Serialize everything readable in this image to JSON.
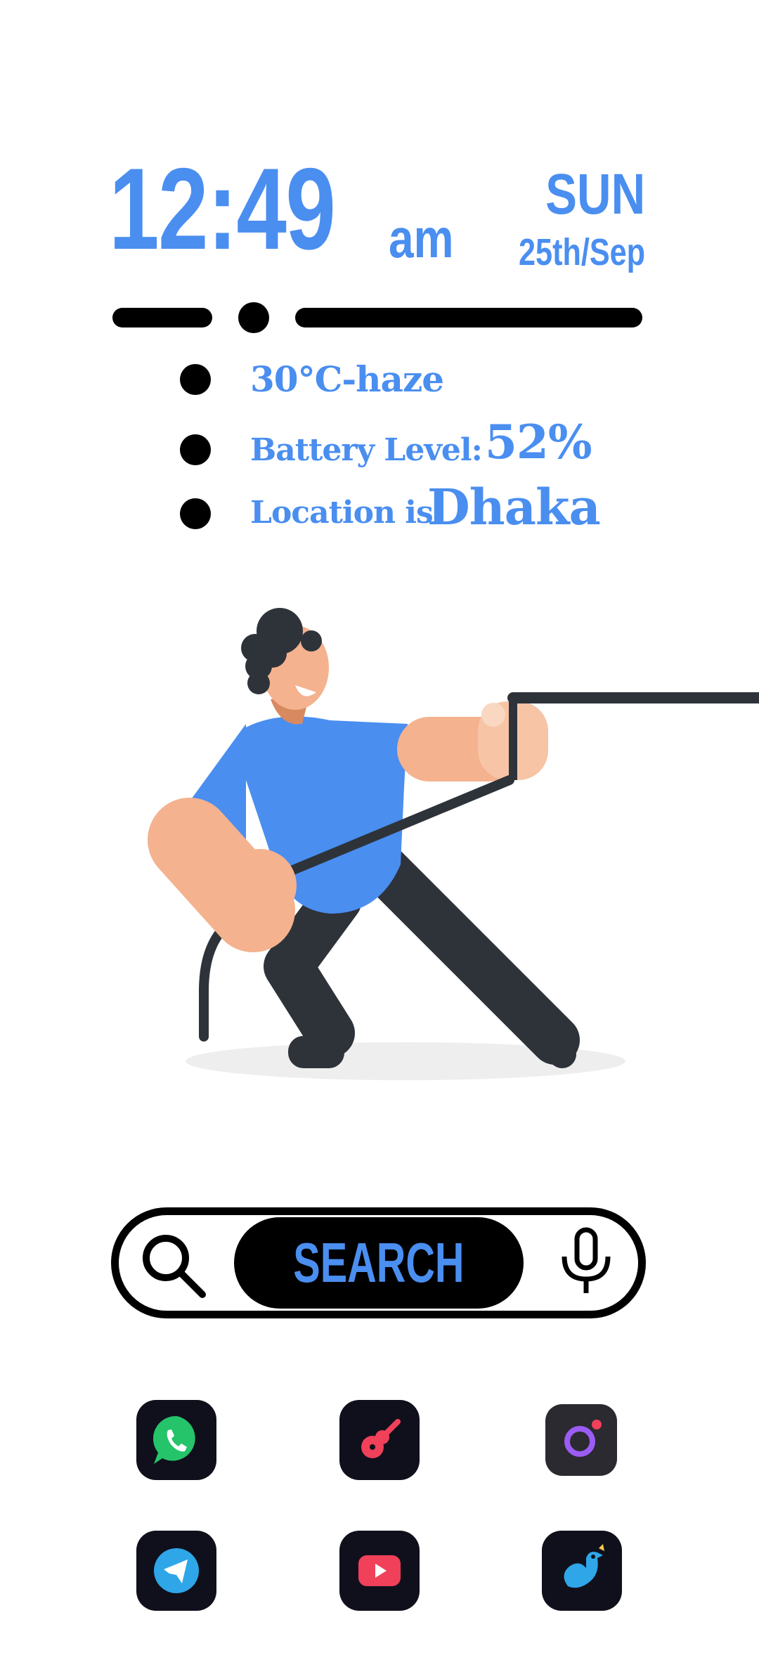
{
  "clock": {
    "time": "12:49",
    "ampm": "am",
    "day": "SUN",
    "date": "25th/Sep"
  },
  "info": {
    "weather": "30°C-haze",
    "battery_label": "Battery Level:",
    "battery_value": "52%",
    "location_label": "Location is",
    "location_value": "Dhaka"
  },
  "search": {
    "label": "SEARCH"
  },
  "apps": [
    {
      "name": "WhatsApp",
      "icon": "whatsapp-icon",
      "color": "#25c46a"
    },
    {
      "name": "Music",
      "icon": "guitar-icon",
      "color": "#f0405a"
    },
    {
      "name": "Camera",
      "icon": "camera-icon",
      "color": "#9b5cf5"
    },
    {
      "name": "Telegram",
      "icon": "telegram-icon",
      "color": "#2ea6e8"
    },
    {
      "name": "YouTube",
      "icon": "youtube-icon",
      "color": "#f0405a"
    },
    {
      "name": "Twitter",
      "icon": "twitter-bird-icon",
      "color": "#2ea6e8"
    }
  ],
  "colors": {
    "accent": "#4a8ef0",
    "background": "#ffffff",
    "ink": "#000000"
  }
}
